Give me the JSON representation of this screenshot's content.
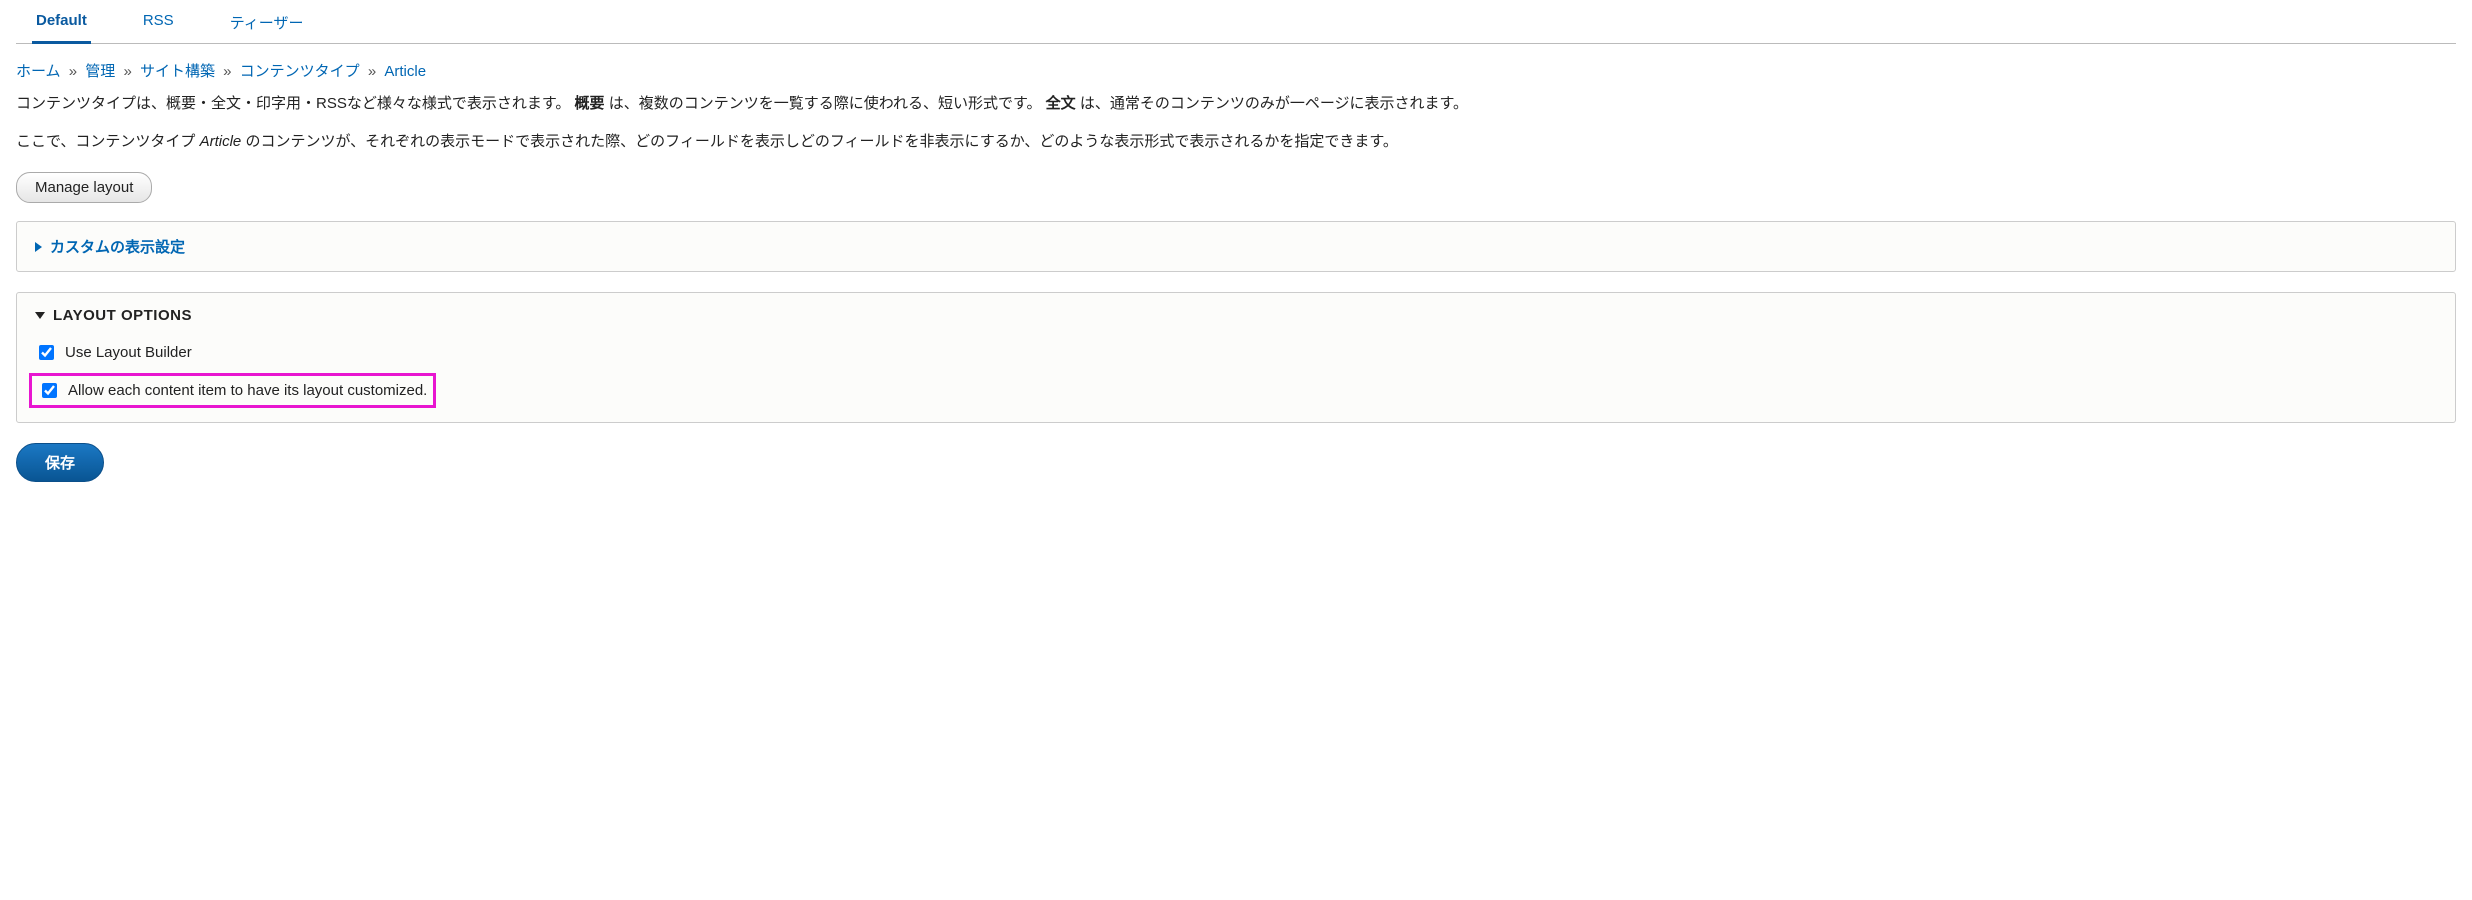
{
  "tabs": {
    "items": [
      {
        "label": "Default",
        "active": true
      },
      {
        "label": "RSS",
        "active": false
      },
      {
        "label": "ティーザー",
        "active": false
      }
    ]
  },
  "breadcrumb": {
    "items": [
      {
        "label": "ホーム"
      },
      {
        "label": "管理"
      },
      {
        "label": "サイト構築"
      },
      {
        "label": "コンテンツタイプ"
      },
      {
        "label": "Article"
      }
    ],
    "separator": "»"
  },
  "description": {
    "p1_before": "コンテンツタイプは、概要・全文・印字用・RSSなど様々な様式で表示されます。",
    "p1_bold1": "概要",
    "p1_mid": "は、複数のコンテンツを一覧する際に使われる、短い形式です。",
    "p1_bold2": "全文",
    "p1_after": "は、通常そのコンテンツのみが一ページに表示されます。",
    "p2_before": "ここで、コンテンツタイプ ",
    "p2_em": "Article",
    "p2_after": " のコンテンツが、それぞれの表示モードで表示された際、どのフィールドを表示しどのフィールドを非表示にするか、どのような表示形式で表示されるかを指定できます。"
  },
  "buttons": {
    "manage_layout": "Manage layout",
    "save": "保存"
  },
  "panels": {
    "custom_display": {
      "title": "カスタムの表示設定"
    },
    "layout_options": {
      "title": "LAYOUT OPTIONS",
      "use_layout_builder": {
        "label": "Use Layout Builder",
        "checked": true
      },
      "allow_custom": {
        "label": "Allow each content item to have its layout customized.",
        "checked": true
      }
    }
  }
}
